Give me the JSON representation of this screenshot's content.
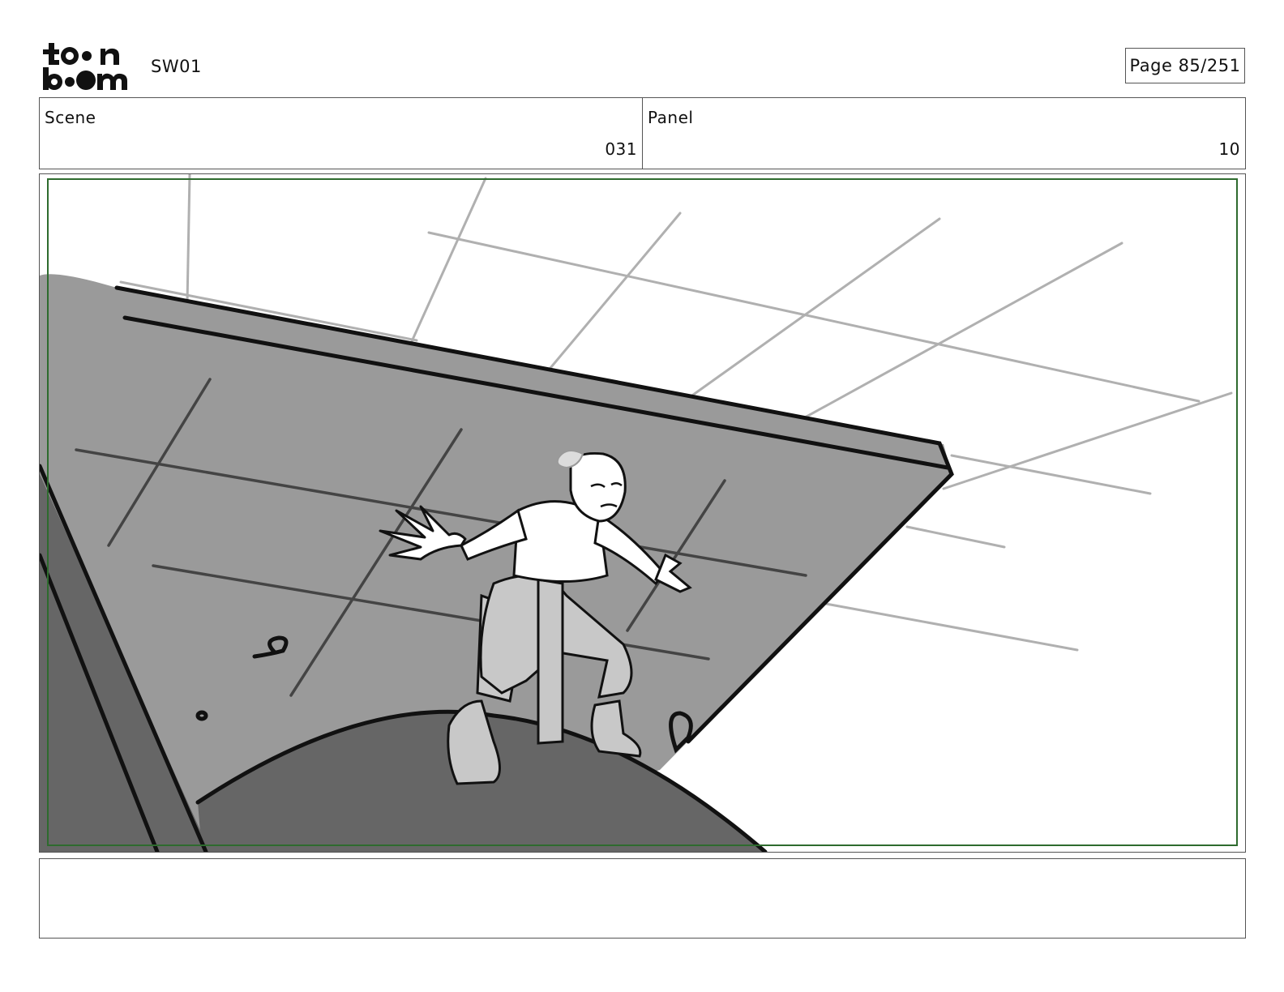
{
  "header": {
    "logo_alt": "toon boom",
    "project": "SW01",
    "page_label": "Page",
    "page_number": "85/251"
  },
  "scene": {
    "label": "Scene",
    "value": "031"
  },
  "panel": {
    "label": "Panel",
    "value": "10"
  },
  "caption": {
    "text": ""
  },
  "colors": {
    "frame_border": "#555555",
    "safe_area": "#2e6b2e",
    "wall": "#9a9a9a",
    "dark_wall": "#666666",
    "floor_grid": "#b0b0b0"
  }
}
